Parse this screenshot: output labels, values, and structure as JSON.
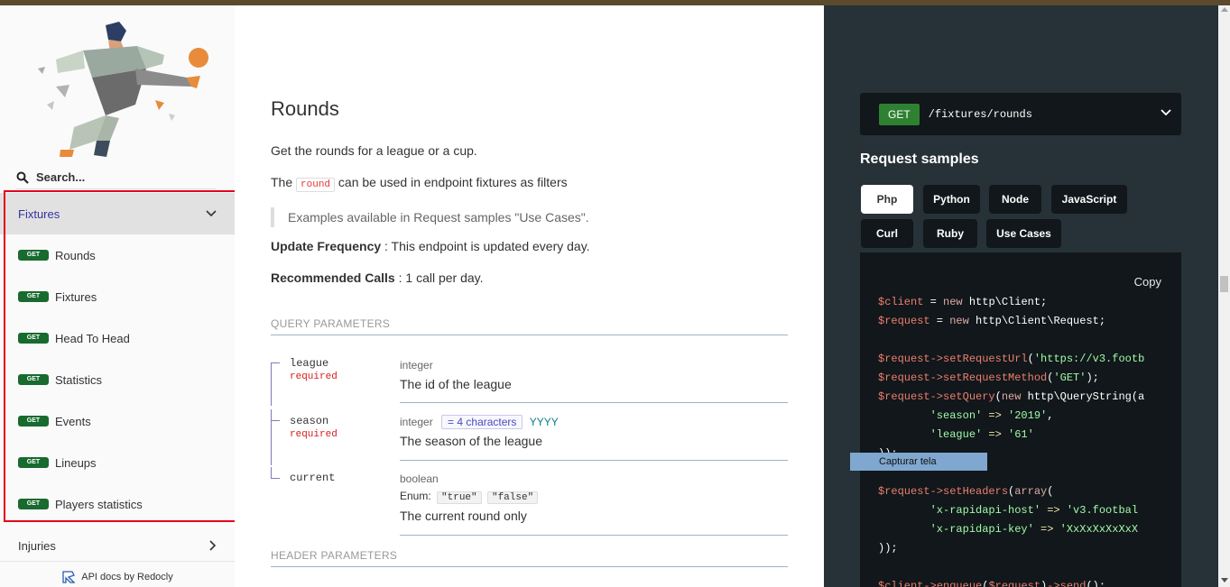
{
  "sidebar": {
    "search_placeholder": "Search...",
    "group": {
      "label": "Fixtures"
    },
    "badge_label": "GET",
    "items": [
      {
        "label": "Rounds"
      },
      {
        "label": "Fixtures"
      },
      {
        "label": "Head To Head"
      },
      {
        "label": "Statistics"
      },
      {
        "label": "Events"
      },
      {
        "label": "Lineups"
      },
      {
        "label": "Players statistics"
      }
    ],
    "collapsed_group": {
      "label": "Injuries"
    },
    "footer": "API docs by Redocly"
  },
  "main": {
    "title": "Rounds",
    "intro": "Get the rounds for a league or a cup.",
    "round_prefix": "The",
    "round_code": "round",
    "round_suffix": "can be used in endpoint fixtures as filters",
    "blockquote": "Examples available in Request samples \"Use Cases\".",
    "update_label": "Update Frequency",
    "update_text": " : This endpoint is updated every day.",
    "calls_label": "Recommended Calls",
    "calls_text": " : 1 call per day.",
    "query_header": "QUERY PARAMETERS",
    "header_header": "HEADER PARAMETERS",
    "params": [
      {
        "name": "league",
        "required": "required",
        "type": "integer",
        "description": "The id of the league"
      },
      {
        "name": "season",
        "required": "required",
        "type": "integer",
        "constraint": "= 4 characters",
        "pattern": "YYYY",
        "description": "The season of the league"
      },
      {
        "name": "current",
        "type": "boolean",
        "enum_label": "Enum:",
        "enum": [
          "\"true\"",
          "\"false\""
        ],
        "description": "The current round only"
      }
    ]
  },
  "right": {
    "method": "GET",
    "path": "/fixtures/rounds",
    "samples_title": "Request samples",
    "tabs": [
      "Php",
      "Python",
      "Node",
      "JavaScript",
      "Curl",
      "Ruby",
      "Use Cases"
    ],
    "active_tab": "Php",
    "copy_label": "Copy",
    "code_lines": [
      "$client = new http\\Client;",
      "$request = new http\\Client\\Request;",
      "",
      "$request->setRequestUrl('https://v3.footb",
      "$request->setRequestMethod('GET');",
      "$request->setQuery(new http\\QueryString(a",
      "        'season' => '2019',",
      "        'league' => '61'",
      "));",
      "",
      "$request->setHeaders(array(",
      "        'x-rapidapi-host' => 'v3.footbal",
      "        'x-rapidapi-key' => 'XxXxXxXxXxX",
      "));",
      "",
      "$client->enqueue($request)->send();"
    ]
  },
  "tooltip": "Capturar tela",
  "colors": {
    "accent": "#32329f",
    "get_badge": "#186a2f",
    "panel_bg": "#263238",
    "highlight": "#e3001b"
  }
}
